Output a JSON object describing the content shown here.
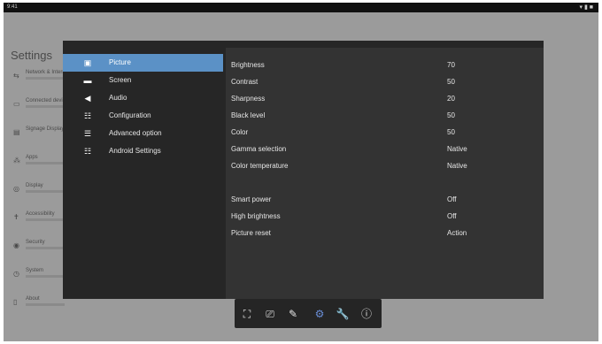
{
  "statusbar": {
    "time": "9:41",
    "icons": "▾ ▮ ■"
  },
  "settings_title": "Settings",
  "background_items": [
    {
      "icon": "⇆",
      "label": "Network & Internet"
    },
    {
      "icon": "▭",
      "label": "Connected devices"
    },
    {
      "icon": "▤",
      "label": "Signage Display"
    },
    {
      "icon": "⁂",
      "label": "Apps"
    },
    {
      "icon": "◎",
      "label": "Display"
    },
    {
      "icon": "✝",
      "label": "Accessibility"
    },
    {
      "icon": "◉",
      "label": "Security"
    },
    {
      "icon": "◷",
      "label": "System"
    },
    {
      "icon": "▯",
      "label": "About"
    }
  ],
  "menu": [
    {
      "icon": "▣",
      "label": "Picture",
      "selected": true
    },
    {
      "icon": "▬",
      "label": "Screen"
    },
    {
      "icon": "◀",
      "label": "Audio"
    },
    {
      "icon": "☷",
      "label": "Configuration"
    },
    {
      "icon": "☰",
      "label": "Advanced option"
    },
    {
      "icon": "☷",
      "label": "Android Settings"
    }
  ],
  "picture_settings": [
    {
      "label": "Brightness",
      "value": "70"
    },
    {
      "label": "Contrast",
      "value": "50"
    },
    {
      "label": "Sharpness",
      "value": "20"
    },
    {
      "label": "Black level",
      "value": "50"
    },
    {
      "label": "Color",
      "value": "50"
    },
    {
      "label": "Gamma selection",
      "value": "Native"
    },
    {
      "label": "Color temperature",
      "value": "Native"
    },
    {
      "label": "",
      "value": "",
      "disabled": true
    },
    {
      "label": "Smart power",
      "value": "Off"
    },
    {
      "label": "High brightness",
      "value": "Off"
    },
    {
      "label": "Picture reset",
      "value": "Action"
    }
  ],
  "toolbar": [
    {
      "icon": "⛶",
      "name": "fullscreen-icon"
    },
    {
      "icon": "⎚",
      "name": "screen-icon"
    },
    {
      "icon": "✎",
      "name": "pen-icon"
    },
    {
      "icon": "⚙",
      "name": "gear-icon",
      "active": true
    },
    {
      "icon": "🔧",
      "name": "wrench-icon"
    },
    {
      "icon": "ⓘ",
      "name": "info-icon"
    }
  ],
  "colors": {
    "selected": "#5b91c6",
    "dialog_bg": "#262626",
    "panel_bg": "#333333",
    "toolbar_active": "#6a8ed8"
  }
}
